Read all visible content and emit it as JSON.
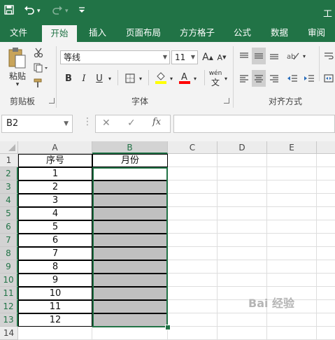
{
  "app": {
    "title_partial": "工"
  },
  "quick_access": {
    "save_icon": "save-icon",
    "undo_icon": "undo-icon",
    "redo_icon": "redo-icon",
    "customize_icon": "customize-icon"
  },
  "ribbon_tabs": [
    "文件",
    "开始",
    "插入",
    "页面布局",
    "方方格子",
    "公式",
    "数据",
    "审阅"
  ],
  "active_tab": "开始",
  "clipboard": {
    "paste_label": "粘贴",
    "group_label": "剪贴板"
  },
  "font": {
    "name": "等线",
    "size": "11",
    "bold": "B",
    "italic": "I",
    "underline": "U",
    "grow": "A",
    "shrink": "A",
    "phonetic": "wén",
    "group_label": "字体",
    "fill_color": "#ffff00",
    "font_color": "#ff0000"
  },
  "alignment": {
    "group_label": "对齐方式"
  },
  "formula_bar": {
    "name_box": "B2",
    "cancel": "✕",
    "enter": "✓",
    "fx": "fx",
    "value": ""
  },
  "columns": [
    "A",
    "B",
    "C",
    "D",
    "E"
  ],
  "selected_column": "B",
  "rows": [
    "1",
    "2",
    "3",
    "4",
    "5",
    "6",
    "7",
    "8",
    "9",
    "10",
    "11",
    "12",
    "13",
    "14"
  ],
  "table": {
    "headers": [
      "序号",
      "月份"
    ],
    "values": [
      "1",
      "2",
      "3",
      "4",
      "5",
      "6",
      "7",
      "8",
      "9",
      "10",
      "11",
      "12"
    ]
  },
  "watermark": "Bai 经验",
  "colors": {
    "excel_green": "#217346",
    "selection_fill": "#c0c0c0"
  }
}
